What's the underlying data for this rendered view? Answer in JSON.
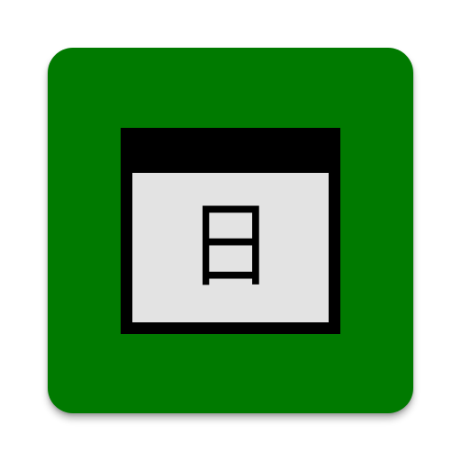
{
  "app_icon": {
    "icon_name": "calendar-window-icon",
    "background_color": "#007a00",
    "window": {
      "frame_color": "#000000",
      "body_color": "#e3e3e3",
      "glyph": "日",
      "glyph_color": "#000000"
    }
  }
}
